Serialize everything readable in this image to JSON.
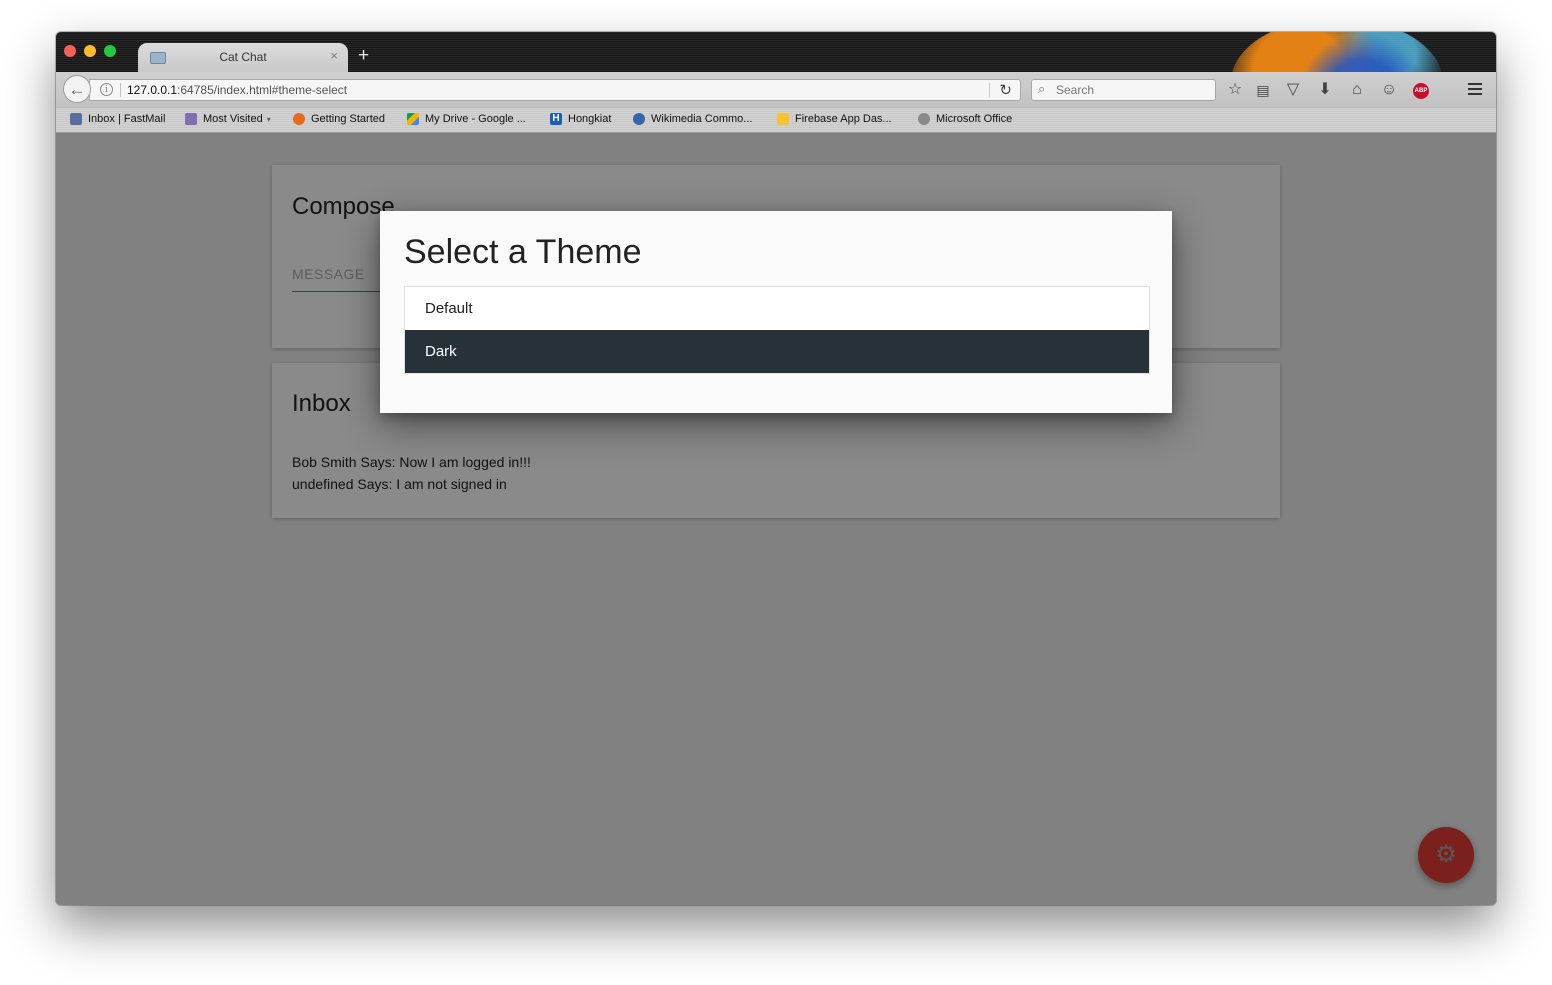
{
  "browser": {
    "tab": {
      "title": "Cat Chat",
      "close": "×"
    },
    "new_tab": "+",
    "url": {
      "host": "127.0.0.1",
      "rest": ":64785/index.html#theme-select"
    },
    "search": {
      "placeholder": "Search"
    },
    "abp_label": "ABP",
    "bookmarks": [
      {
        "label": "Inbox | FastMail",
        "icon": "fastmail-icon",
        "color": "#5b6f9e"
      },
      {
        "label": "Most Visited",
        "icon": "most-visited-icon",
        "color": "#7d6fb0"
      },
      {
        "label": "Getting Started",
        "icon": "firefox-icon",
        "color": "#e66a1e"
      },
      {
        "label": "My Drive - Google ...",
        "icon": "google-drive-icon",
        "color": "#f4b400"
      },
      {
        "label": "Hongkiat",
        "icon": "hongkiat-icon",
        "color": "#1a5fb4"
      },
      {
        "label": "Wikimedia Commo...",
        "icon": "wikimedia-icon",
        "color": "#3366aa"
      },
      {
        "label": "Firebase App Das...",
        "icon": "firebase-icon",
        "color": "#f7c430"
      },
      {
        "label": "Microsoft Office",
        "icon": "globe-icon",
        "color": "#8a8a8a"
      }
    ]
  },
  "page": {
    "compose": {
      "title": "Compose",
      "message_placeholder": "MESSAGE"
    },
    "inbox": {
      "title": "Inbox",
      "messages": [
        "Bob Smith Says: Now I am logged in!!!",
        "undefined Says: I am not signed in"
      ]
    },
    "fab_icon": "gear-icon"
  },
  "dialog": {
    "title": "Select a Theme",
    "options": [
      {
        "label": "Default",
        "selected": false
      },
      {
        "label": "Dark",
        "selected": true
      }
    ]
  },
  "colors": {
    "dark_theme_bg": "#263238",
    "fab": "#e43b34",
    "input_underline": "#3f9540"
  }
}
